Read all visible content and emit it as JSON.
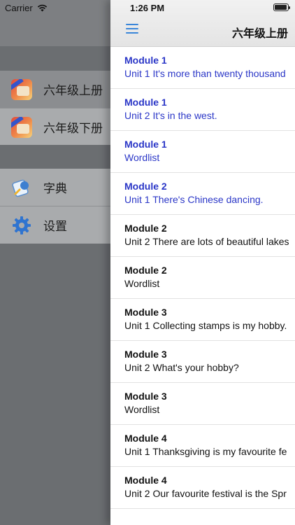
{
  "status": {
    "carrier": "Carrier",
    "time": "1:26 PM"
  },
  "drawer": {
    "books": [
      {
        "label": "六年级上册",
        "icon": "textbook-icon",
        "selected": true
      },
      {
        "label": "六年级下册",
        "icon": "textbook-icon",
        "selected": false
      }
    ],
    "tools": [
      {
        "label": "字典",
        "icon": "dictionary-icon"
      },
      {
        "label": "设置",
        "icon": "gear-icon"
      }
    ]
  },
  "nav": {
    "title": "六年级上册",
    "menu_icon": "hamburger-menu-icon"
  },
  "lessons": [
    {
      "module": "Module 1",
      "unit": "Unit 1 It's more than twenty thousand",
      "highlight": true
    },
    {
      "module": "Module 1",
      "unit": "Unit 2 It's in the west.",
      "highlight": true
    },
    {
      "module": "Module 1",
      "unit": "Wordlist",
      "highlight": true
    },
    {
      "module": "Module 2",
      "unit": "Unit 1 There's Chinese dancing.",
      "highlight": true
    },
    {
      "module": "Module 2",
      "unit": "Unit 2 There are lots of beautiful lakes",
      "highlight": false
    },
    {
      "module": "Module 2",
      "unit": "Wordlist",
      "highlight": false
    },
    {
      "module": "Module 3",
      "unit": "Unit 1 Collecting stamps is my hobby.",
      "highlight": false
    },
    {
      "module": "Module 3",
      "unit": "Unit 2 What's your hobby?",
      "highlight": false
    },
    {
      "module": "Module 3",
      "unit": "Wordlist",
      "highlight": false
    },
    {
      "module": "Module 4",
      "unit": "Unit 1 Thanksgiving is my favourite fe",
      "highlight": false
    },
    {
      "module": "Module 4",
      "unit": "Unit 2 Our favourite festival is the Spr",
      "highlight": false
    }
  ],
  "colors": {
    "highlight_text": "#2a36c7",
    "accent": "#3a86d9"
  }
}
